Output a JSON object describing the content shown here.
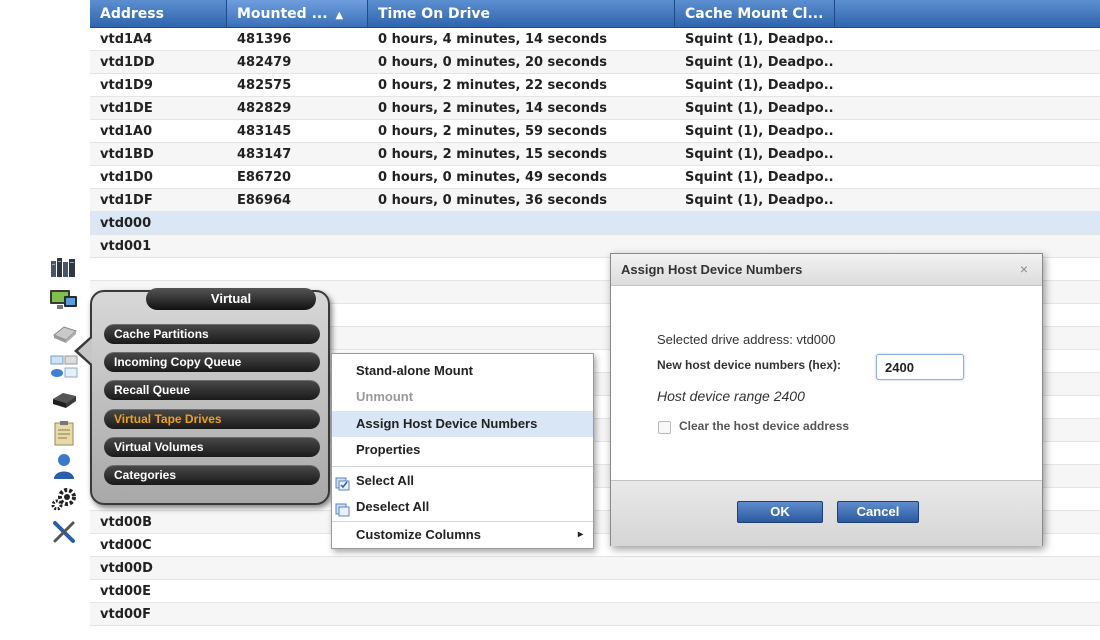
{
  "table": {
    "columns": [
      {
        "label": "Address",
        "sorted": false
      },
      {
        "label": "Mounted ...",
        "sorted": true,
        "sort_arrow": "▲"
      },
      {
        "label": "Time On Drive",
        "sorted": false
      },
      {
        "label": "Cache Mount Cl...",
        "sorted": false
      },
      {
        "label": "",
        "sorted": false
      }
    ],
    "rows": [
      {
        "address": "vtd1A4",
        "mounted": "481396",
        "time": "0 hours, 4 minutes, 14 seconds",
        "cache": "Squint (1), Deadpo..."
      },
      {
        "address": "vtd1DD",
        "mounted": "482479",
        "time": "0 hours, 0 minutes, 20 seconds",
        "cache": "Squint (1), Deadpo..."
      },
      {
        "address": "vtd1D9",
        "mounted": "482575",
        "time": "0 hours, 2 minutes, 22 seconds",
        "cache": "Squint (1), Deadpo..."
      },
      {
        "address": "vtd1DE",
        "mounted": "482829",
        "time": "0 hours, 2 minutes, 14 seconds",
        "cache": "Squint (1), Deadpo..."
      },
      {
        "address": "vtd1A0",
        "mounted": "483145",
        "time": "0 hours, 2 minutes, 59 seconds",
        "cache": "Squint (1), Deadpo..."
      },
      {
        "address": "vtd1BD",
        "mounted": "483147",
        "time": "0 hours, 2 minutes, 15 seconds",
        "cache": "Squint (1), Deadpo..."
      },
      {
        "address": "vtd1D0",
        "mounted": "E86720",
        "time": "0 hours, 0 minutes, 49 seconds",
        "cache": "Squint (1), Deadpo..."
      },
      {
        "address": "vtd1DF",
        "mounted": "E86964",
        "time": "0 hours, 0 minutes, 36 seconds",
        "cache": "Squint (1), Deadpo..."
      },
      {
        "address": "vtd000",
        "mounted": "",
        "time": "",
        "cache": "",
        "selected": true
      },
      {
        "address": "vtd001",
        "mounted": "",
        "time": "",
        "cache": ""
      },
      {
        "address": "",
        "mounted": "",
        "time": "",
        "cache": ""
      },
      {
        "address": "",
        "mounted": "",
        "time": "",
        "cache": ""
      },
      {
        "address": "",
        "mounted": "",
        "time": "",
        "cache": ""
      },
      {
        "address": "",
        "mounted": "",
        "time": "",
        "cache": ""
      },
      {
        "address": "",
        "mounted": "",
        "time": "",
        "cache": ""
      },
      {
        "address": "",
        "mounted": "",
        "time": "",
        "cache": ""
      },
      {
        "address": "",
        "mounted": "",
        "time": "",
        "cache": ""
      },
      {
        "address": "",
        "mounted": "",
        "time": "",
        "cache": ""
      },
      {
        "address": "",
        "mounted": "",
        "time": "",
        "cache": ""
      },
      {
        "address": "",
        "mounted": "",
        "time": "",
        "cache": ""
      },
      {
        "address": "",
        "mounted": "",
        "time": "",
        "cache": ""
      },
      {
        "address": "vtd00B",
        "mounted": "",
        "time": "",
        "cache": ""
      },
      {
        "address": "vtd00C",
        "mounted": "",
        "time": "",
        "cache": ""
      },
      {
        "address": "vtd00D",
        "mounted": "",
        "time": "",
        "cache": ""
      },
      {
        "address": "vtd00E",
        "mounted": "",
        "time": "",
        "cache": ""
      },
      {
        "address": "vtd00F",
        "mounted": "",
        "time": "",
        "cache": ""
      }
    ]
  },
  "rail_icons": [
    "system-icon",
    "monitor-icon",
    "physical-drive-icon",
    "virtual-icon",
    "tape-drive-icon",
    "clipboard-icon",
    "user-icon",
    "settings-icon",
    "tools-icon"
  ],
  "virtual_menu": {
    "title": "Virtual",
    "items": [
      {
        "label": "Cache Partitions",
        "active": false
      },
      {
        "label": "Incoming Copy Queue",
        "active": false
      },
      {
        "label": "Recall Queue",
        "active": false
      },
      {
        "label": "Virtual Tape Drives",
        "active": true
      },
      {
        "label": "Virtual Volumes",
        "active": false
      },
      {
        "label": "Categories",
        "active": false
      }
    ],
    "active_color": "#f0a020"
  },
  "context_menu": {
    "items": [
      {
        "label": "Stand-alone Mount",
        "disabled": false
      },
      {
        "label": "Unmount",
        "disabled": true
      },
      {
        "label": "Assign Host Device Numbers",
        "disabled": false,
        "hover": true
      },
      {
        "label": "Properties",
        "disabled": false
      },
      {
        "label": "Select All",
        "icon": "select-all-icon"
      },
      {
        "label": "Deselect All",
        "icon": "deselect-all-icon"
      },
      {
        "label": "Customize Columns",
        "submenu": "▸"
      }
    ]
  },
  "dialog": {
    "title": "Assign Host Device Numbers",
    "close": "×",
    "selected_drive": "Selected drive address: vtd000",
    "new_numbers_label": "New host device numbers (hex):",
    "new_numbers_value": "2400",
    "range_text": "Host device range 2400",
    "clear_label": "Clear the host device address",
    "ok_label": "OK",
    "cancel_label": "Cancel"
  },
  "colors": {
    "header_blue": "#2f65ad",
    "selected_row": "#dbe7f4",
    "button_blue": "#2c5a9e"
  }
}
